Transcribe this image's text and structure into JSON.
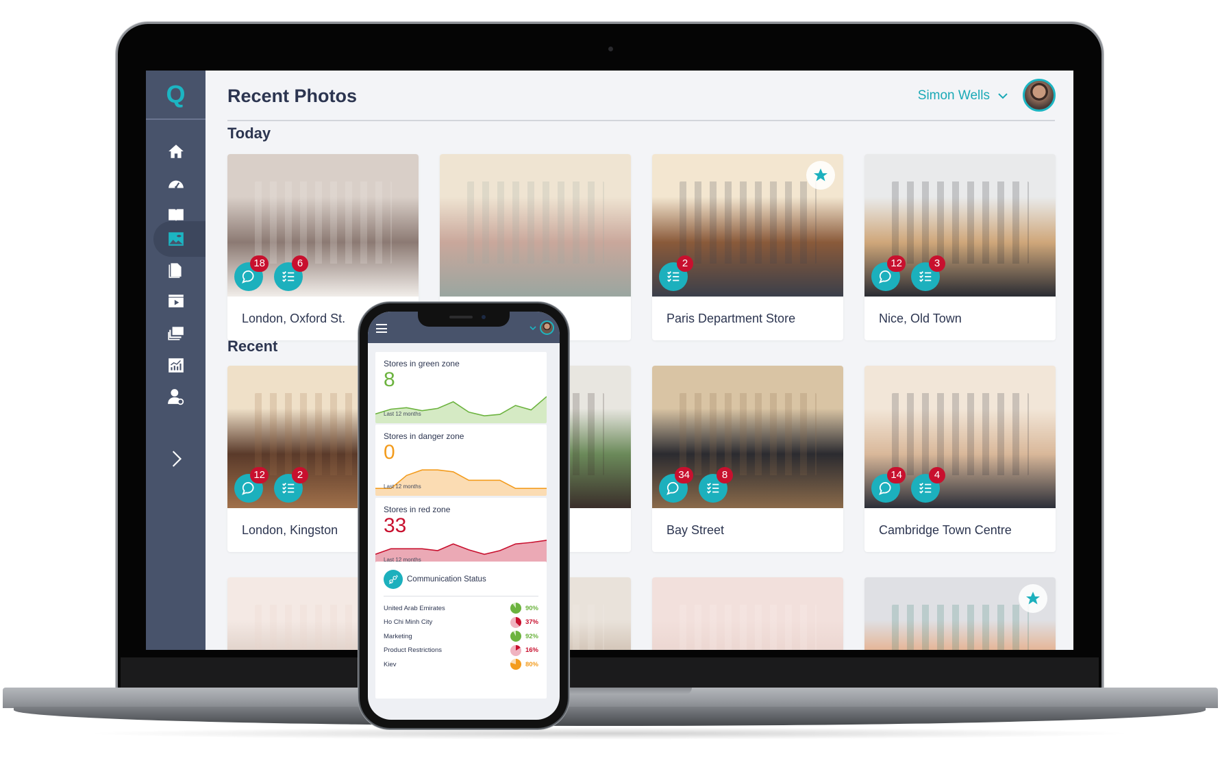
{
  "app": {
    "logo_letter": "Q",
    "page_title": "Recent Photos",
    "user": {
      "name": "Simon Wells"
    },
    "colors": {
      "accent": "#1cb0bd",
      "sidebar": "#48536b",
      "badge": "#c8102e",
      "text": "#2c3550",
      "background": "#f3f4f7"
    }
  },
  "sidebar": {
    "items": [
      {
        "id": "home",
        "icon": "home-icon",
        "active": false
      },
      {
        "id": "dashboard",
        "icon": "speedometer-icon",
        "active": false
      },
      {
        "id": "library",
        "icon": "book-icon",
        "active": false
      },
      {
        "id": "photos",
        "icon": "image-icon",
        "active": true
      },
      {
        "id": "documents",
        "icon": "document-icon",
        "active": false
      },
      {
        "id": "videos",
        "icon": "video-icon",
        "active": false
      },
      {
        "id": "gallery",
        "icon": "stack-icon",
        "active": false
      },
      {
        "id": "reports",
        "icon": "chart-icon",
        "active": false
      },
      {
        "id": "user-settings",
        "icon": "user-gear-icon",
        "active": false
      }
    ],
    "expand_icon": "chevron-right-icon"
  },
  "sections": [
    {
      "title": "Today",
      "cards": [
        {
          "label": "London, Oxford St.",
          "comments": "18",
          "tasks": "6",
          "starred": false,
          "photo_palette": [
            "#d9cfc8",
            "#8c7a73",
            "#f1ede9"
          ]
        },
        {
          "label": "",
          "comments": null,
          "tasks": null,
          "starred": false,
          "photo_palette": [
            "#efe4d2",
            "#c9a79b",
            "#9aa6a0"
          ]
        },
        {
          "label": "Paris Department Store",
          "comments": null,
          "tasks": "2",
          "starred": true,
          "photo_palette": [
            "#f3e6d0",
            "#8a5a3a",
            "#3b3f4a"
          ]
        },
        {
          "label": "Nice, Old Town",
          "comments": "12",
          "tasks": "3",
          "starred": false,
          "photo_palette": [
            "#e9eaeb",
            "#cfa77a",
            "#2a2c33"
          ]
        }
      ]
    },
    {
      "title": "Recent",
      "cards": [
        {
          "label": "London, Kingston",
          "comments": "12",
          "tasks": "2",
          "starred": false,
          "photo_palette": [
            "#efe0c8",
            "#5a3a2a",
            "#a0704a"
          ]
        },
        {
          "label": "",
          "comments": null,
          "tasks": null,
          "starred": false,
          "photo_palette": [
            "#e8e6e0",
            "#6b8a5a",
            "#3a2e2a"
          ]
        },
        {
          "label": "Bay Street",
          "comments": "34",
          "tasks": "8",
          "starred": false,
          "photo_palette": [
            "#d9c4a4",
            "#2b2b30",
            "#8a6a4a"
          ]
        },
        {
          "label": "Cambridge Town Centre",
          "comments": "14",
          "tasks": "4",
          "starred": false,
          "photo_palette": [
            "#f2e6d8",
            "#d9b89a",
            "#2b2e38"
          ]
        }
      ]
    },
    {
      "title": "",
      "cards": [
        {
          "label": "",
          "comments": null,
          "tasks": null,
          "starred": false,
          "photo_palette": [
            "#f4e9e4",
            "#d9c9c0",
            "#e8d2c8"
          ]
        },
        {
          "label": "",
          "comments": null,
          "tasks": null,
          "starred": false,
          "photo_palette": [
            "#e9e2da",
            "#c9b8a8",
            "#f4eee8"
          ]
        },
        {
          "label": "",
          "comments": null,
          "tasks": null,
          "starred": false,
          "photo_palette": [
            "#f2e0dc",
            "#e9d2cc",
            "#faf1ee"
          ]
        },
        {
          "label": "",
          "comments": null,
          "tasks": null,
          "starred": true,
          "photo_palette": [
            "#dfe0e4",
            "#e8a070",
            "#2a7a6a"
          ]
        }
      ]
    }
  ],
  "phone": {
    "kpis": [
      {
        "title": "Stores in green zone",
        "value": "8",
        "footer": "Last 12 months",
        "color": "#6cb33f",
        "fill": "#d5eac4",
        "trend": [
          0.25,
          0.38,
          0.42,
          0.34,
          0.4,
          0.58,
          0.3,
          0.2,
          0.24,
          0.48,
          0.36,
          0.72
        ]
      },
      {
        "title": "Stores in danger zone",
        "value": "0",
        "footer": "Last 12 months",
        "color": "#f39c1e",
        "fill": "#fbdcb3",
        "trend": [
          0.2,
          0.2,
          0.55,
          0.7,
          0.7,
          0.65,
          0.42,
          0.42,
          0.42,
          0.2,
          0.2,
          0.2
        ]
      },
      {
        "title": "Stores in red zone",
        "value": "33",
        "footer": "Last 12 months",
        "color": "#c8102e",
        "fill": "#eba9b5",
        "trend": [
          0.4,
          0.55,
          0.55,
          0.55,
          0.5,
          0.68,
          0.52,
          0.4,
          0.5,
          0.68,
          0.72,
          0.78
        ]
      }
    ],
    "communication": {
      "title": "Communication Status",
      "rows": [
        {
          "name": "United Arab Emirates",
          "percent": 90,
          "label": "90%",
          "color": "#6cb33f",
          "track": "#d5eac4"
        },
        {
          "name": "Ho Chi Minh City",
          "percent": 37,
          "label": "37%",
          "color": "#c8102e",
          "track": "#f0b3c0"
        },
        {
          "name": "Marketing",
          "percent": 92,
          "label": "92%",
          "color": "#6cb33f",
          "track": "#d5eac4"
        },
        {
          "name": "Product Restrictions",
          "percent": 16,
          "label": "16%",
          "color": "#c8102e",
          "track": "#f0b3c0"
        },
        {
          "name": "Kiev",
          "percent": 80,
          "label": "80%",
          "color": "#f39c1e",
          "track": "#fbdcb3"
        }
      ]
    }
  }
}
